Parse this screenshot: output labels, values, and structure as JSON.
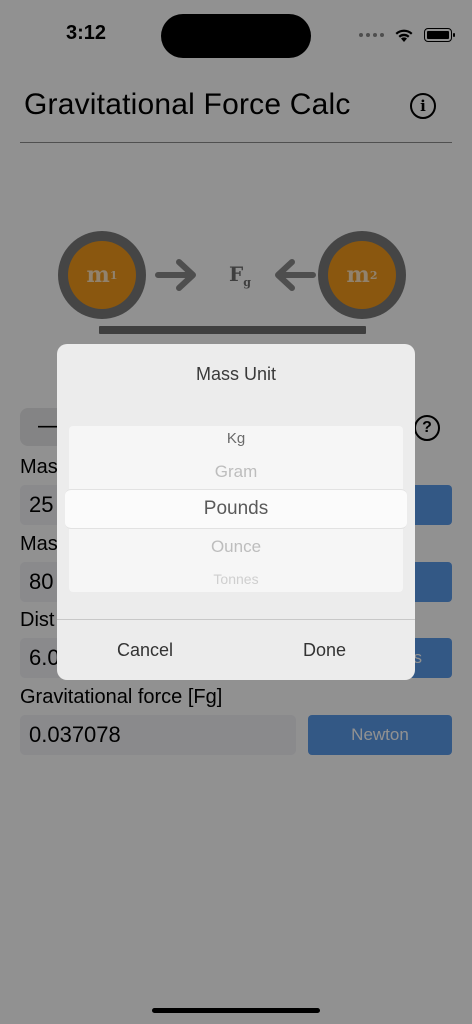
{
  "status_bar": {
    "time": "3:12"
  },
  "header": {
    "title": "Gravitational Force Calc"
  },
  "diagram": {
    "mass1": "m",
    "mass1_sup": "1",
    "mass2": "m",
    "mass2_sup": "2",
    "force": "F",
    "force_sub": "g"
  },
  "form": {
    "segment_label": "—",
    "help": "?",
    "mass1_label": "Mas",
    "mass1_value": "25",
    "mass2_label": "Mas",
    "mass2_value": "80",
    "distance_label": "Dist",
    "distance_value": "6.0",
    "distance_unit_visible": "s",
    "force_label": "Gravitational force [Fg]",
    "force_value": "0.037078",
    "force_unit": "Newton"
  },
  "dialog": {
    "title": "Mass Unit",
    "options": [
      "Kg",
      "Gram",
      "Pounds",
      "Ounce",
      "Tonnes"
    ],
    "selected": "Pounds",
    "cancel_label": "Cancel",
    "done_label": "Done"
  }
}
